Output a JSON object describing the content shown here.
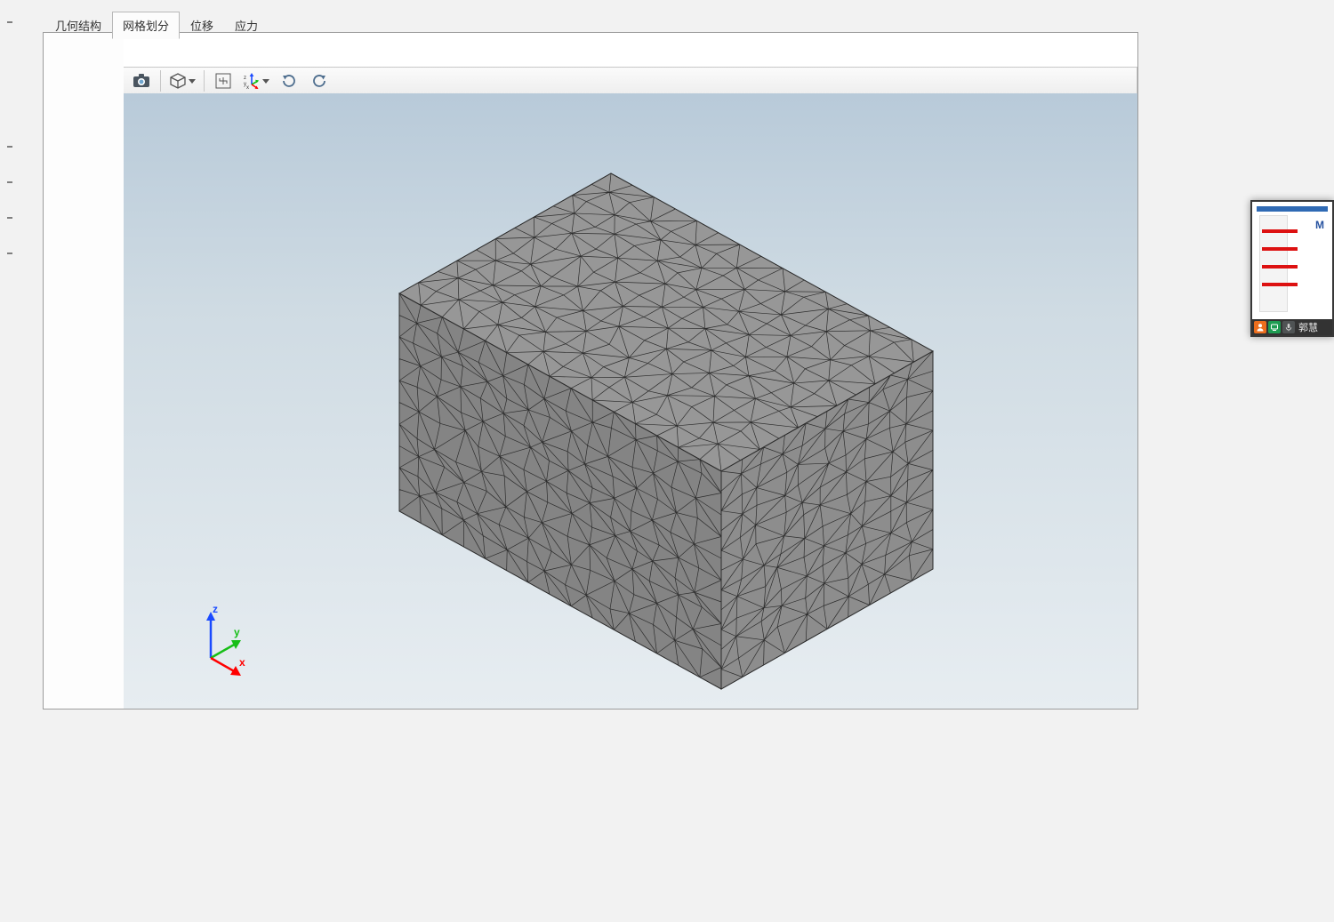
{
  "tabs": {
    "geometry": "几何结构",
    "mesh": "网格划分",
    "displacement": "位移",
    "stress": "应力",
    "active_index": 1
  },
  "toolbar": {
    "screenshot": "screenshot",
    "cube_view": "cube-view",
    "fit_view": "fit-to-view",
    "orientation": "orientation-axes",
    "rotate_cw": "rotate-cw",
    "rotate_ccw": "rotate-ccw"
  },
  "axes": {
    "x": "x",
    "y": "y",
    "z": "z"
  },
  "share_overlay": {
    "username": "郭慧"
  },
  "colors": {
    "axis_x": "#ff0000",
    "axis_y": "#17be17",
    "axis_z": "#1b4bff"
  }
}
